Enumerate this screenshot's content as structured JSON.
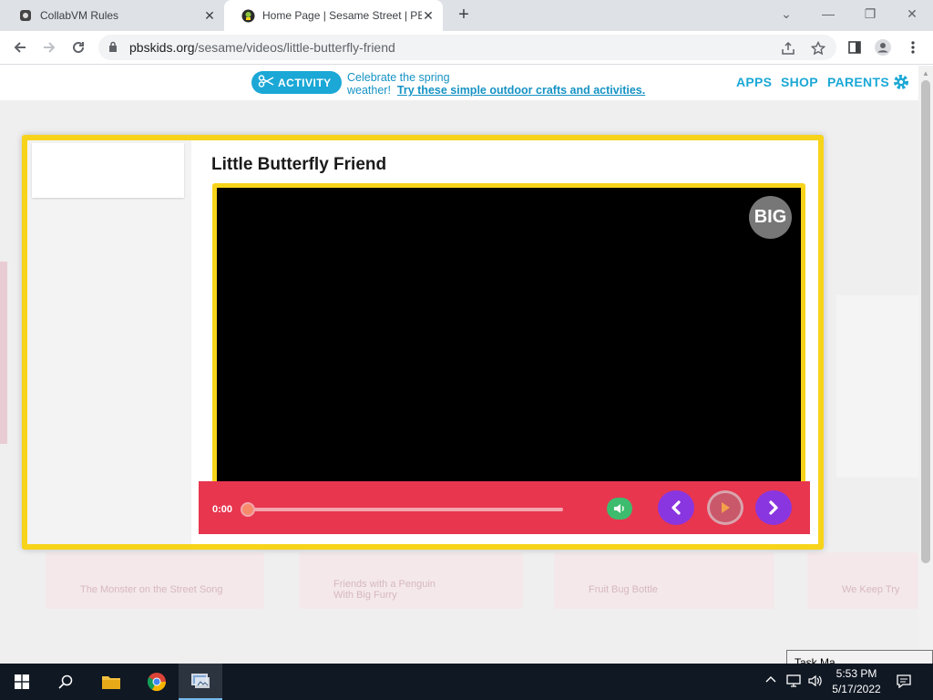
{
  "browser": {
    "tabs": [
      {
        "title": "CollabVM Rules",
        "close": "✕"
      },
      {
        "title": "Home Page | Sesame Street | PBS",
        "close": "✕"
      }
    ],
    "new_tab": "+",
    "window_controls": {
      "minimize": "—",
      "restore": "❐",
      "close": "✕",
      "dropdown": "⌄"
    },
    "url_host": "pbskids.org",
    "url_path": "/sesame/videos/little-butterfly-friend"
  },
  "site": {
    "activity_label": "ACTIVITY",
    "promo_line1": "Celebrate the spring",
    "promo_line2_plain": "weather!",
    "promo_link": "Try these simple outdoor crafts and activities.",
    "nav": {
      "apps": "APPS",
      "shop": "SHOP",
      "parents": "PARENTS"
    }
  },
  "player": {
    "title": "Little Butterfly Friend",
    "big_label": "BIG",
    "time": "0:00",
    "progress": 0
  },
  "background_cards": [
    {
      "label": "The Monster on the Street Song"
    },
    {
      "label": "Friends with a Penguin\nWith Big Furry"
    },
    {
      "label": "Fruit Bug Bottle"
    },
    {
      "label": "We Keep Try"
    }
  ],
  "taskbar": {
    "time": "5:53 PM",
    "date": "5/17/2022",
    "tooltip": "Task Ma..."
  },
  "colors": {
    "frame_yellow": "#f7d31a",
    "controls_red": "#e8364f",
    "pbs_blue": "#1ba8d6",
    "nav_purple": "#8a36e0",
    "volume_green": "#3dbc6e"
  }
}
